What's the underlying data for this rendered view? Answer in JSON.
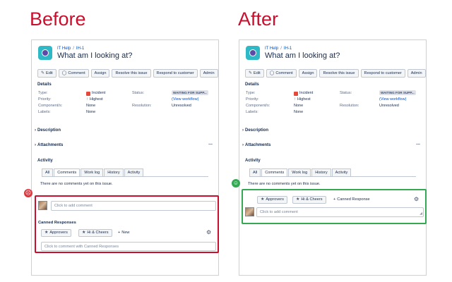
{
  "labels": {
    "before": "Before",
    "after": "After"
  },
  "colors": {
    "heading": "#c8102e",
    "bad_outline": "#c8102e",
    "good_outline": "#34a853",
    "link": "#0052cc"
  },
  "issue": {
    "breadcrumb_project": "IT Help",
    "breadcrumb_key": "IH-1",
    "title": "What am I looking at?",
    "toolbar": {
      "edit": "Edit",
      "comment": "Comment",
      "assign": "Assign",
      "resolve": "Resolve this issue",
      "respond": "Respond to customer",
      "admin": "Admin"
    },
    "details_title": "Details",
    "fields": {
      "type_label": "Type:",
      "type_value": "Incident",
      "priority_label": "Priority:",
      "priority_value": "Highest",
      "components_label": "Component/s:",
      "components_value": "None",
      "labels_label": "Labels:",
      "labels_value": "None",
      "status_label": "Status:",
      "status_value": "WAITING FOR SUPP...",
      "workflow_link": "(View workflow)",
      "resolution_label": "Resolution:",
      "resolution_value": "Unresolved"
    },
    "description": "Description",
    "attachments": "Attachments",
    "attachments_more": "...",
    "activity": "Activity",
    "tabs": [
      "All",
      "Comments",
      "Work log",
      "History",
      "Activity"
    ],
    "no_comments": "There are no comments yet on this issue."
  },
  "before_panel": {
    "comment_placeholder": "Click to add comment",
    "canned_title": "Canned Responses",
    "approvers": "Approvers",
    "hi_cheers": "Hi & Cheers",
    "new": "New",
    "canned_placeholder": "Click to comment with Canned Responses"
  },
  "after_panel": {
    "approvers": "Approvers",
    "hi_cheers": "Hi & Cheers",
    "canned_response": "Canned Response",
    "comment_placeholder": "Click to add comment"
  },
  "icons": {
    "sad_face": "☹",
    "happy_face": "☺",
    "star": "★",
    "plus": "+",
    "gear": "⚙",
    "pencil": "✎",
    "speech": "◯",
    "chevron": "›",
    "arrow_up": "↑",
    "resize": "◢"
  }
}
